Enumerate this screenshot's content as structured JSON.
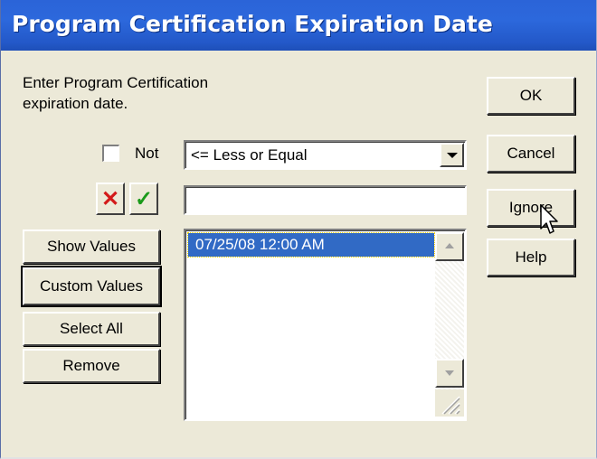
{
  "window": {
    "title": "Program Certification Expiration Date"
  },
  "prompt": {
    "line1": "Enter Program Certification",
    "line2": "expiration date."
  },
  "buttons": {
    "ok": "OK",
    "cancel": "Cancel",
    "ignore": "Ignore",
    "help": "Help",
    "show_values": "Show Values",
    "custom_values": "Custom Values",
    "select_all": "Select All",
    "remove": "Remove"
  },
  "filter": {
    "not_label": "Not",
    "not_checked": false,
    "operator_selected": "<= Less or Equal",
    "value_input": "",
    "clear_icon": "x-icon",
    "accept_icon": "checkmark-icon"
  },
  "values_list": {
    "items": [
      "07/25/08 12:00 AM"
    ],
    "selected_index": 0
  },
  "colors": {
    "title_bar": "#2b64d8",
    "dialog_bg": "#ece9d8",
    "selection": "#316ac5",
    "clear_icon": "#d31a1a",
    "accept_icon": "#1a9a1a"
  }
}
